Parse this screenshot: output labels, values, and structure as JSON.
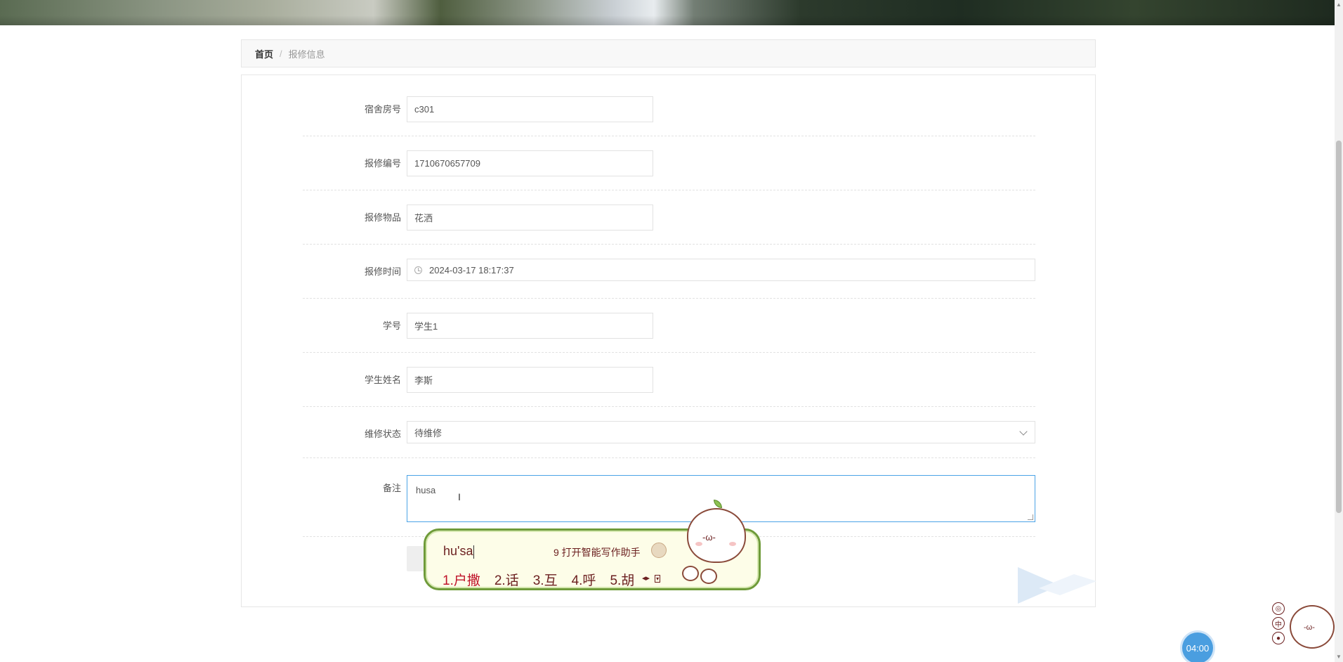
{
  "breadcrumb": {
    "home": "首页",
    "separator": "/",
    "current": "报修信息"
  },
  "form": {
    "room": {
      "label": "宿舍房号",
      "value": "c301"
    },
    "repair_no": {
      "label": "报修编号",
      "value": "1710670657709"
    },
    "item": {
      "label": "报修物品",
      "value": "花洒"
    },
    "time": {
      "label": "报修时间",
      "value": "2024-03-17 18:17:37",
      "icon": "clock-icon"
    },
    "student_id": {
      "label": "学号",
      "value": "学生1"
    },
    "student_name": {
      "label": "学生姓名",
      "value": "李斯"
    },
    "status": {
      "label": "维修状态",
      "value": "待维修",
      "icon": "chevron-down-icon"
    },
    "remark": {
      "label": "备注",
      "value": "husa"
    }
  },
  "ime": {
    "composition": "hu'sa",
    "hint": "9 打开智能写作助手",
    "candidates": [
      "1.户撒",
      "2.话",
      "3.互",
      "4.呼",
      "5.胡"
    ],
    "face": "-ω-"
  },
  "side_widget": {
    "tools": [
      "◎",
      "中",
      "●"
    ],
    "face": "-ω-"
  },
  "timer": "04:00",
  "colors": {
    "accent_focus": "#4ba3e6",
    "ime_border": "#6f9b3a",
    "ime_text": "#6b1f1f",
    "timer_bg": "#4a9ee0"
  }
}
